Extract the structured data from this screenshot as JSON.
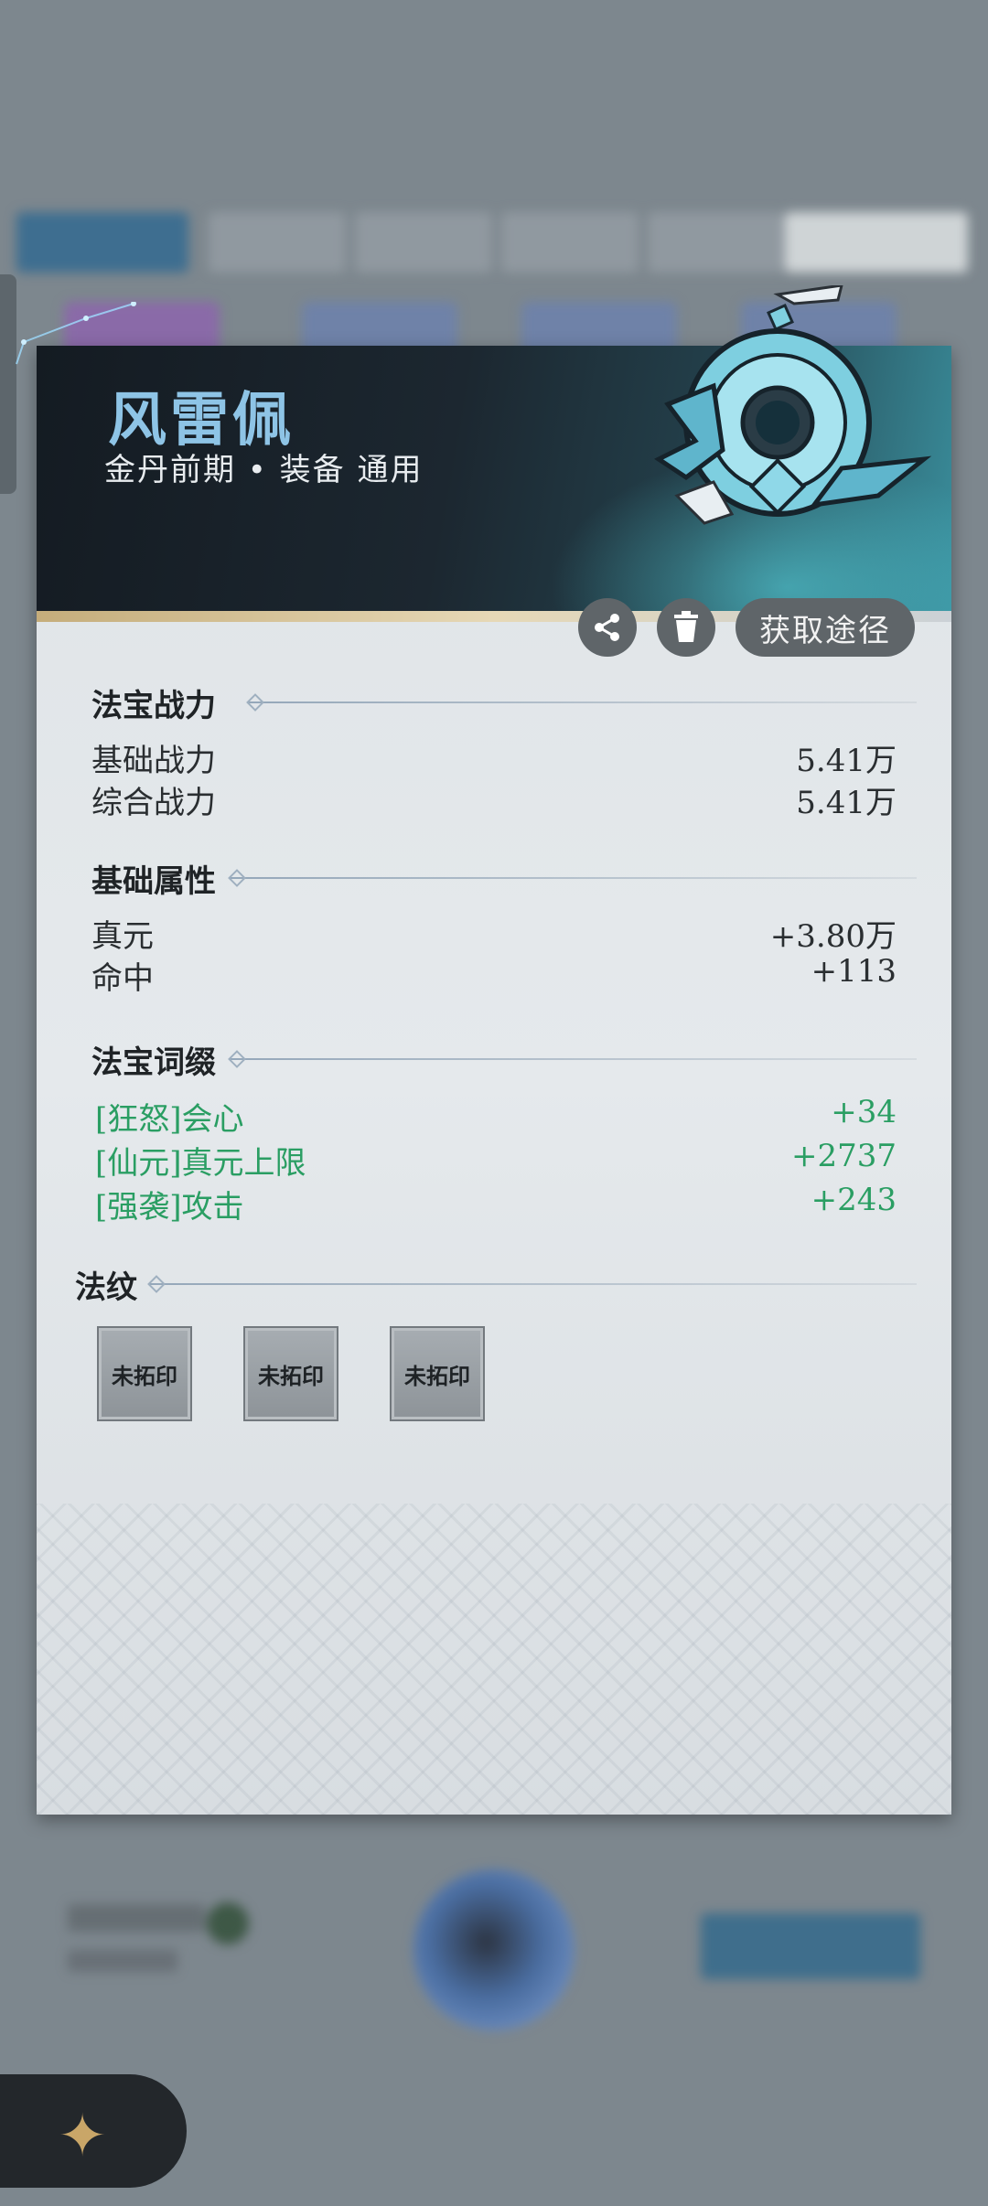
{
  "item": {
    "name": "风雷佩",
    "subtitle": "金丹前期 • 装备 通用"
  },
  "actions": {
    "share_icon": "share-icon",
    "delete_icon": "trash-icon",
    "acquire_label": "获取途径"
  },
  "sections": {
    "combat": {
      "title": "法宝战力",
      "rows": [
        {
          "label": "基础战力",
          "value": "5.41万"
        },
        {
          "label": "综合战力",
          "value": "5.41万"
        }
      ]
    },
    "base_attrs": {
      "title": "基础属性",
      "rows": [
        {
          "label": "真元",
          "value": "+3.80万"
        },
        {
          "label": "命中",
          "value": "+113"
        }
      ]
    },
    "affixes": {
      "title": "法宝词缀",
      "rows": [
        {
          "label": "[狂怒]会心",
          "value": "+34"
        },
        {
          "label": "[仙元]真元上限",
          "value": "+2737"
        },
        {
          "label": "[强袭]攻击",
          "value": "+243"
        }
      ]
    },
    "runes": {
      "title": "法纹",
      "slots": [
        "未拓印",
        "未拓印",
        "未拓印"
      ]
    }
  },
  "colors": {
    "title": "#8ec4e6",
    "affix_green": "#2a9e63",
    "header_dark": "#141b22",
    "accent_cyan": "#3a8e9c"
  }
}
